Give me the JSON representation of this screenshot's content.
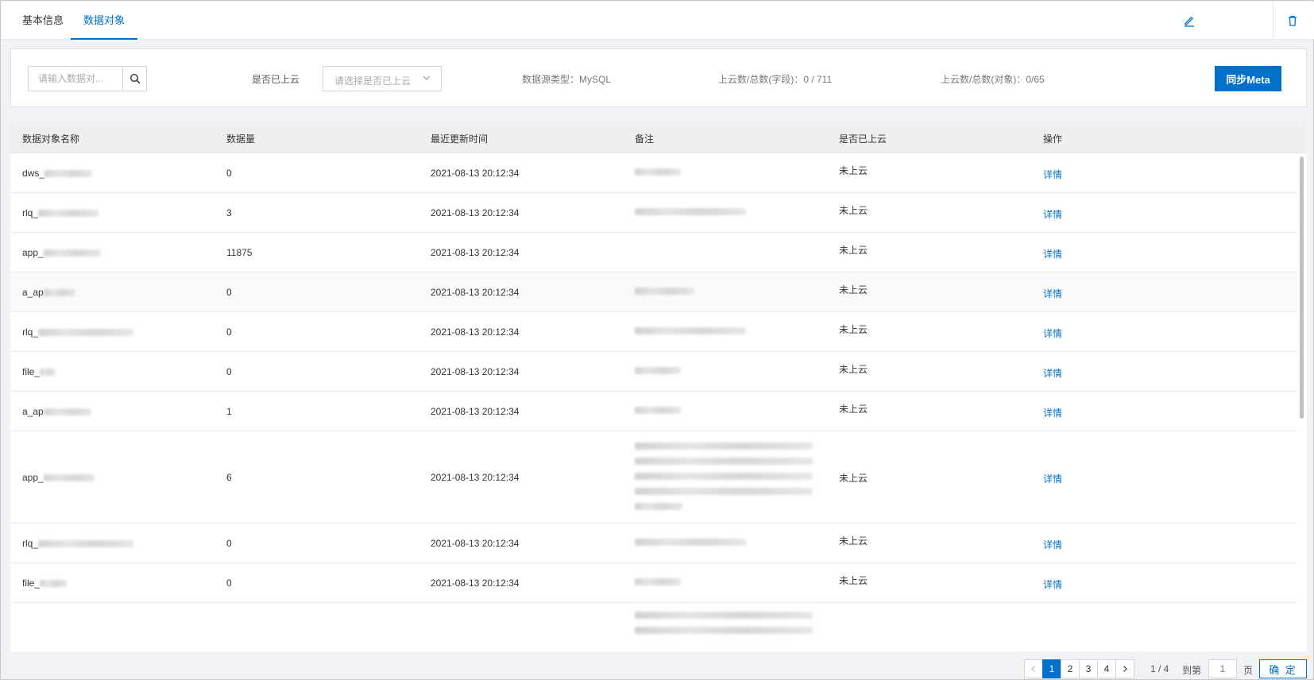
{
  "tabs": [
    {
      "label": "基本信息",
      "active": false
    },
    {
      "label": "数据对象",
      "active": true
    }
  ],
  "toolbar": {
    "edit_icon": "pencil-icon",
    "delete_icon": "trash-icon"
  },
  "filter": {
    "search_placeholder": "请输入数据对...",
    "cloud_label": "是否已上云",
    "cloud_placeholder": "请选择是否已上云",
    "datasource_type": "数据源类型：MySQL",
    "field_ratio": "上云数/总数(字段)：0 / 711",
    "object_ratio": "上云数/总数(对象)：0/65",
    "sync_button": "同步Meta"
  },
  "table": {
    "columns": [
      "数据对象名称",
      "数据量",
      "最近更新时间",
      "备注",
      "是否已上云",
      "操作"
    ],
    "rows": [
      {
        "name_prefix": "dws_",
        "count": "0",
        "updated": "2021-08-13 20:12:34",
        "status": "未上云",
        "action": "详情"
      },
      {
        "name_prefix": "rlq_",
        "count": "3",
        "updated": "2021-08-13 20:12:34",
        "status": "未上云",
        "action": "详情"
      },
      {
        "name_prefix": "app_",
        "count": "11875",
        "updated": "2021-08-13 20:12:34",
        "status": "未上云",
        "action": "详情"
      },
      {
        "name_prefix": "a_ap",
        "count": "0",
        "updated": "2021-08-13 20:12:34",
        "status": "未上云",
        "action": "详情"
      },
      {
        "name_prefix": "rlq_",
        "count": "0",
        "updated": "2021-08-13 20:12:34",
        "status": "未上云",
        "action": "详情"
      },
      {
        "name_prefix": "file_",
        "count": "0",
        "updated": "2021-08-13 20:12:34",
        "status": "未上云",
        "action": "详情"
      },
      {
        "name_prefix": "a_ap",
        "count": "1",
        "updated": "2021-08-13 20:12:34",
        "status": "未上云",
        "action": "详情"
      },
      {
        "name_prefix": "app_",
        "count": "6",
        "updated": "2021-08-13 20:12:34",
        "status": "未上云",
        "action": "详情"
      },
      {
        "name_prefix": "rlq_",
        "count": "0",
        "updated": "2021-08-13 20:12:34",
        "status": "未上云",
        "action": "详情"
      },
      {
        "name_prefix": "file_",
        "count": "0",
        "updated": "2021-08-13 20:12:34",
        "status": "未上云",
        "action": "详情"
      }
    ]
  },
  "pagination": {
    "pages": [
      "1",
      "2",
      "3",
      "4"
    ],
    "current": "1",
    "summary": "1 / 4",
    "goto_label": "到第",
    "goto_placeholder": "1",
    "page_unit": "页",
    "confirm": "确 定"
  }
}
